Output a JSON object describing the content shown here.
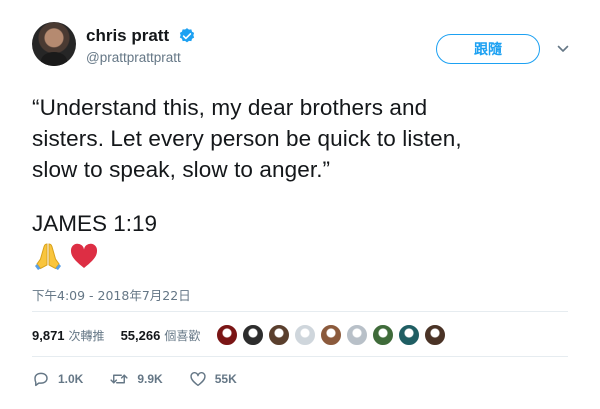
{
  "author": {
    "display_name": "chris pratt",
    "handle": "@prattprattpratt",
    "verified_icon": "verified-badge-icon"
  },
  "follow_button": {
    "label": "跟隨"
  },
  "tweet": {
    "lines": [
      "“Understand this, my dear brothers and",
      "sisters. Let every person be quick to listen,",
      "slow to speak, slow to anger.”"
    ],
    "verse": "JAMES 1:19",
    "emojis": [
      "folded-hands-emoji",
      "red-heart-emoji"
    ],
    "timestamp": "下午4:09 - 2018年7月22日"
  },
  "stats": {
    "retweets": {
      "count": "9,871",
      "label": "次轉推"
    },
    "likes": {
      "count": "55,266",
      "label": "個喜歡"
    },
    "liker_avatar_colors": [
      "#7a1515",
      "#2d2d2d",
      "#5a3f2d",
      "#cfd6dc",
      "#8b5a3c",
      "#b8c0c8",
      "#3f6b3a",
      "#1f5e63",
      "#4a3326"
    ]
  },
  "actions": {
    "reply_count": "1.0K",
    "retweet_count": "9.9K",
    "like_count": "55K"
  },
  "colors": {
    "accent": "#1da1f2",
    "muted": "#657786",
    "text": "#14171a",
    "heart": "#e0245e"
  }
}
